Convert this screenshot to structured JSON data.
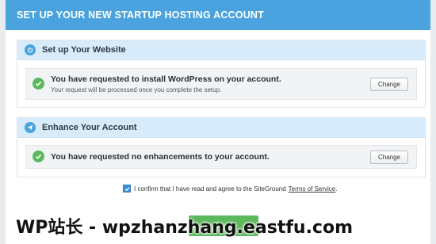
{
  "header": {
    "title": "SET UP YOUR NEW STARTUP HOSTING ACCOUNT"
  },
  "sections": [
    {
      "title": "Set up Your Website",
      "icon": "power-icon",
      "row_title": "You have requested to install WordPress on your account.",
      "row_sub": "Your request will be processed once you complete the setup.",
      "button": "Change"
    },
    {
      "title": "Enhance Your Account",
      "icon": "paper-plane-icon",
      "row_title": "You have requested no enhancements to your account.",
      "button": "Change"
    }
  ],
  "confirm": {
    "text": "I confirm that I have read and agree to the SiteGround",
    "link": "Terms of Service",
    "end": ".",
    "checked": true
  },
  "watermark": "WP站长 - wpzhanzhang.eastfu.com",
  "colors": {
    "header": "#4aa3df",
    "section_head": "#d8ebfa",
    "check": "#5cb85c",
    "button_green": "#5cb85c"
  }
}
